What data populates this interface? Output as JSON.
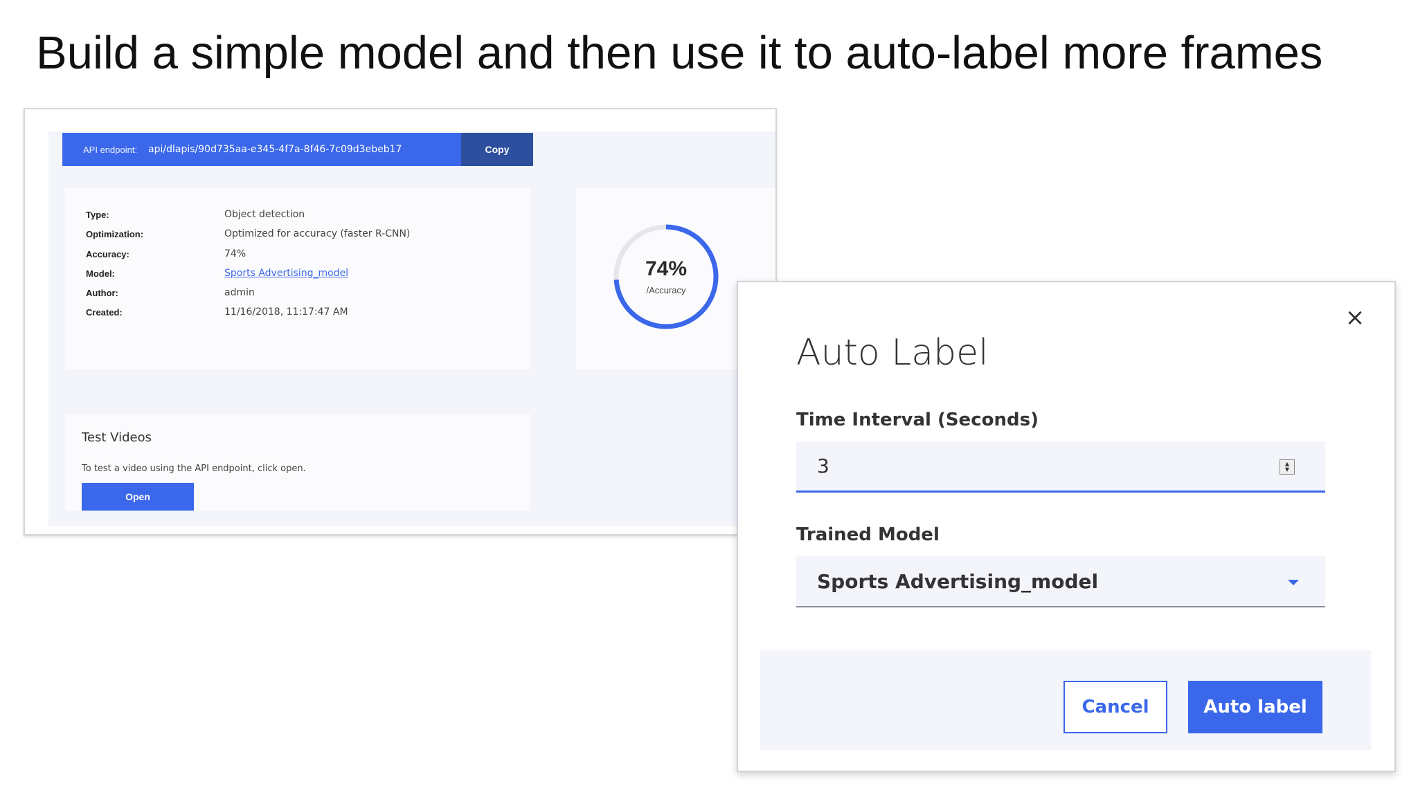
{
  "slide": {
    "title": "Build a simple model and then use it to auto-label more frames"
  },
  "model_panel": {
    "api": {
      "label": "API endpoint:",
      "value": "api/dlapis/90d735aa-e345-4f7a-8f46-7c09d3ebeb17",
      "copy_label": "Copy"
    },
    "details": [
      {
        "key": "Type:",
        "value": "Object detection"
      },
      {
        "key": "Optimization:",
        "value": "Optimized for accuracy (faster R-CNN)"
      },
      {
        "key": "Accuracy:",
        "value": "74%"
      },
      {
        "key": "Model:",
        "value": "Sports Advertising_model"
      },
      {
        "key": "Author:",
        "value": "admin"
      },
      {
        "key": "Created:",
        "value": "11/16/2018, 11:17:47 AM"
      }
    ],
    "accuracy": {
      "value_label": "74%",
      "caption": "/Accuracy",
      "fraction": 0.74,
      "color": "#3b68ea",
      "track_color": "#e4e6ea"
    },
    "test_videos": {
      "title": "Test Videos",
      "description": "To test a video using the API endpoint, click open.",
      "open_label": "Open"
    }
  },
  "dialog": {
    "title": "Auto Label",
    "close_icon": "×",
    "interval": {
      "label": "Time Interval (Seconds)",
      "value": "3",
      "stepper_up": "▲",
      "stepper_down": "▼"
    },
    "model": {
      "label": "Trained Model",
      "selected": "Sports Advertising_model"
    },
    "cancel_label": "Cancel",
    "auto_label": "Auto label"
  },
  "colors": {
    "accent": "#3b68ea",
    "accent_dark": "#2d4f9e",
    "panel_bg": "#f3f5fb"
  }
}
